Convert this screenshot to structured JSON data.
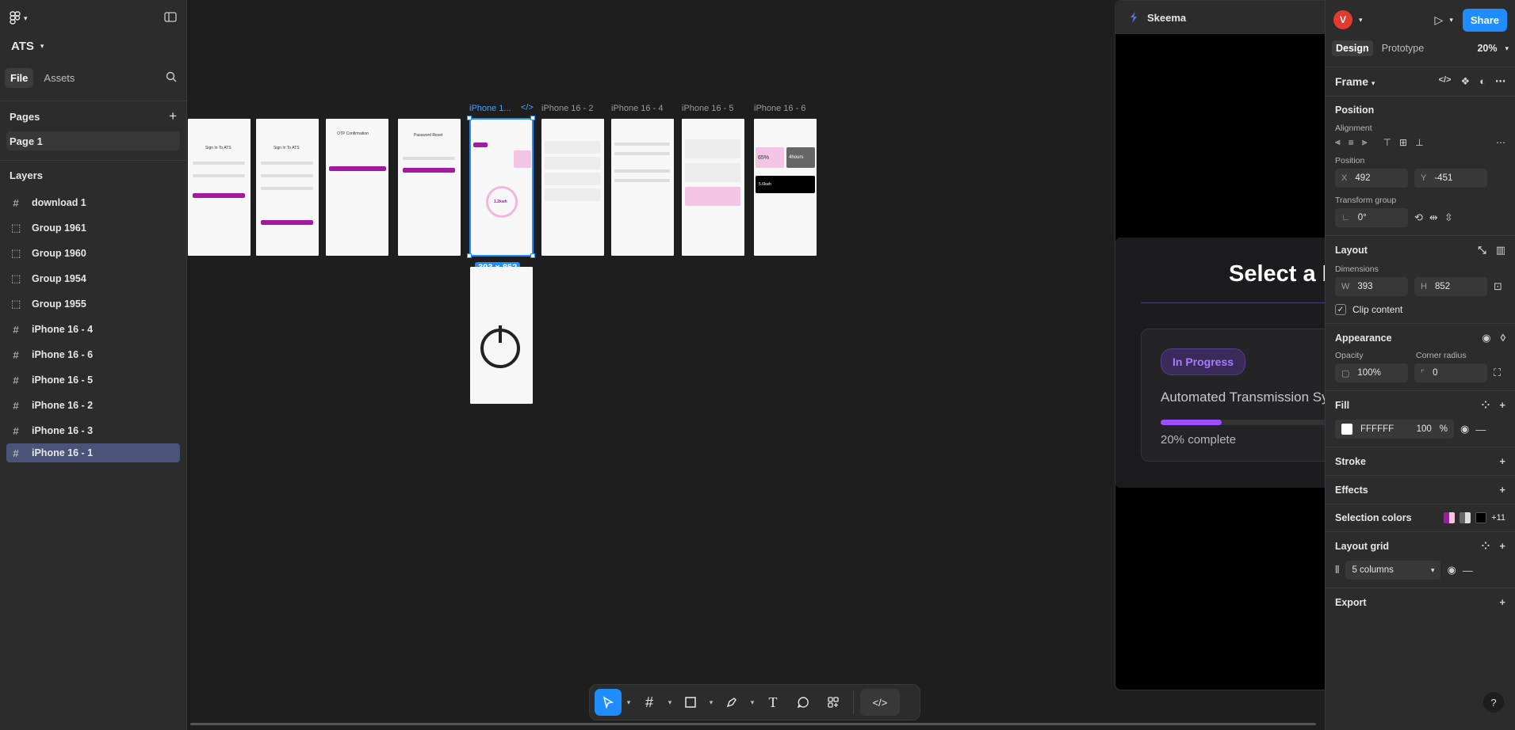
{
  "app": {
    "project_name": "ATS"
  },
  "left_panel": {
    "tabs": [
      {
        "label": "File"
      },
      {
        "label": "Assets"
      }
    ],
    "pages_label": "Pages",
    "pages": [
      {
        "label": "Page 1"
      }
    ],
    "layers_label": "Layers",
    "layers": [
      {
        "label": "download 1",
        "icon": "frame-icon"
      },
      {
        "label": "Group 1961",
        "icon": "group-icon"
      },
      {
        "label": "Group 1960",
        "icon": "group-icon"
      },
      {
        "label": "Group 1954",
        "icon": "group-icon"
      },
      {
        "label": "Group 1955",
        "icon": "group-icon"
      },
      {
        "label": "iPhone 16 - 4",
        "icon": "frame-icon"
      },
      {
        "label": "iPhone 16 - 6",
        "icon": "frame-icon"
      },
      {
        "label": "iPhone 16 - 5",
        "icon": "frame-icon"
      },
      {
        "label": "iPhone 16 - 2",
        "icon": "frame-icon"
      },
      {
        "label": "iPhone 16 - 3",
        "icon": "frame-icon"
      },
      {
        "label": "iPhone 16 - 1",
        "icon": "frame-icon",
        "selected": true
      }
    ]
  },
  "canvas": {
    "frame_labels": {
      "selected": "iPhone 1...",
      "f2": "iPhone 16 - 2",
      "f4": "iPhone 16 - 4",
      "f5": "iPhone 16 - 5",
      "f6": "iPhone 16 - 6"
    },
    "selection_badge": "393 × 852",
    "mini_texts": {
      "signin1": "Sign In To ATS",
      "signin2": "Sign In To ATS",
      "otp": "OTP Confirmation",
      "reset": "Password Reset",
      "energy": "1.2kwh",
      "energy2": "5.6kwh",
      "pct": "65%",
      "hours": "4hours"
    }
  },
  "plugin": {
    "title": "Skeema",
    "modal_title": "Select a Project",
    "project": {
      "status": "In Progress",
      "name": "Automated Transmission System API",
      "progress": 20,
      "progress_label": "20% complete"
    },
    "accent": "#9b4dff"
  },
  "right_panel": {
    "avatar_letter": "V",
    "share_label": "Share",
    "tabs": [
      {
        "label": "Design"
      },
      {
        "label": "Prototype"
      }
    ],
    "zoom": "20%",
    "frame_label": "Frame",
    "position_section": "Position",
    "alignment_label": "Alignment",
    "position_label": "Position",
    "x_label": "X",
    "x_value": "492",
    "y_label": "Y",
    "y_value": "-451",
    "transform_label": "Transform group",
    "rotation_value": "0°",
    "layout_section": "Layout",
    "dimensions_label": "Dimensions",
    "w_label": "W",
    "w_value": "393",
    "h_label": "H",
    "h_value": "852",
    "clip_label": "Clip content",
    "appearance_section": "Appearance",
    "opacity_label": "Opacity",
    "opacity_value": "100%",
    "radius_label": "Corner radius",
    "radius_value": "0",
    "fill_section": "Fill",
    "fill_hex": "FFFFFF",
    "fill_opacity": "100",
    "fill_pct": "%",
    "stroke_section": "Stroke",
    "effects_section": "Effects",
    "selection_colors_section": "Selection colors",
    "selection_colors_more": "+11",
    "layout_grid_section": "Layout grid",
    "grid_value": "5 columns",
    "export_section": "Export"
  },
  "colors": {
    "primary": "#1f8cff",
    "avatar": "#e23b2e",
    "brand_purple": "#a11aa1"
  }
}
